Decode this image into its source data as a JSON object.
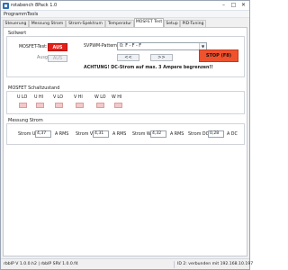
{
  "window": {
    "title": "rotabench 8Pack 1.0",
    "minimize": "–",
    "maximize": "□",
    "close": "✕"
  },
  "menu": [
    "Programm",
    "Tools"
  ],
  "tabs": [
    "Steuerung",
    "Messung Strom",
    "Strom-Spektrum",
    "Temperatur",
    "MOSFET Test",
    "Setup",
    "PID-Tuning"
  ],
  "active_tab": "MOSFET Test",
  "sollwert": {
    "title": "Sollwert",
    "mosfet_test_label": "MOSFET-Test:",
    "mosfet_test_value": "AUS",
    "svpwm_label": "SVPWM-Pattern:",
    "svpwm_value": "0: F - F - F",
    "stop_button": "STOP (F8)",
    "ausgabe_label": "Ausgabe",
    "ausgabe_value": "AUS",
    "prev_button": "<<",
    "next_button": ">>",
    "warning": "ACHTUNG! DC-Strom auf max. 3 Ampere begrenzen!!"
  },
  "schaltzustand": {
    "title": "MOSFET Schaltzustand",
    "labels": [
      "U LO",
      "U HI",
      "V LO",
      "V HI",
      "W LO",
      "W HI"
    ],
    "states": [
      "off",
      "off",
      "off",
      "off",
      "off",
      "off"
    ],
    "led_off_color": "#f3c8c8"
  },
  "messung": {
    "title": "Messung Strom",
    "items": [
      {
        "label": "Strom U:",
        "value": "4,37",
        "unit": "A RMS"
      },
      {
        "label": "Strom V:",
        "value": "4,31",
        "unit": "A RMS"
      },
      {
        "label": "Strom W:",
        "value": "4,32",
        "unit": "A RMS"
      },
      {
        "label": "Strom DC:",
        "value": "0,28",
        "unit": "A DC"
      }
    ]
  },
  "statusbar": {
    "left": "rbbIP V 1.0.0.h2 | rbbIP SRV 1.0.0.f4",
    "right": "ID 2: verbunden mit 192.168.10.197"
  },
  "colors": {
    "accent_red": "#e21f18",
    "stop_orange": "#f0522e",
    "app_blue": "#2f6fb5"
  }
}
